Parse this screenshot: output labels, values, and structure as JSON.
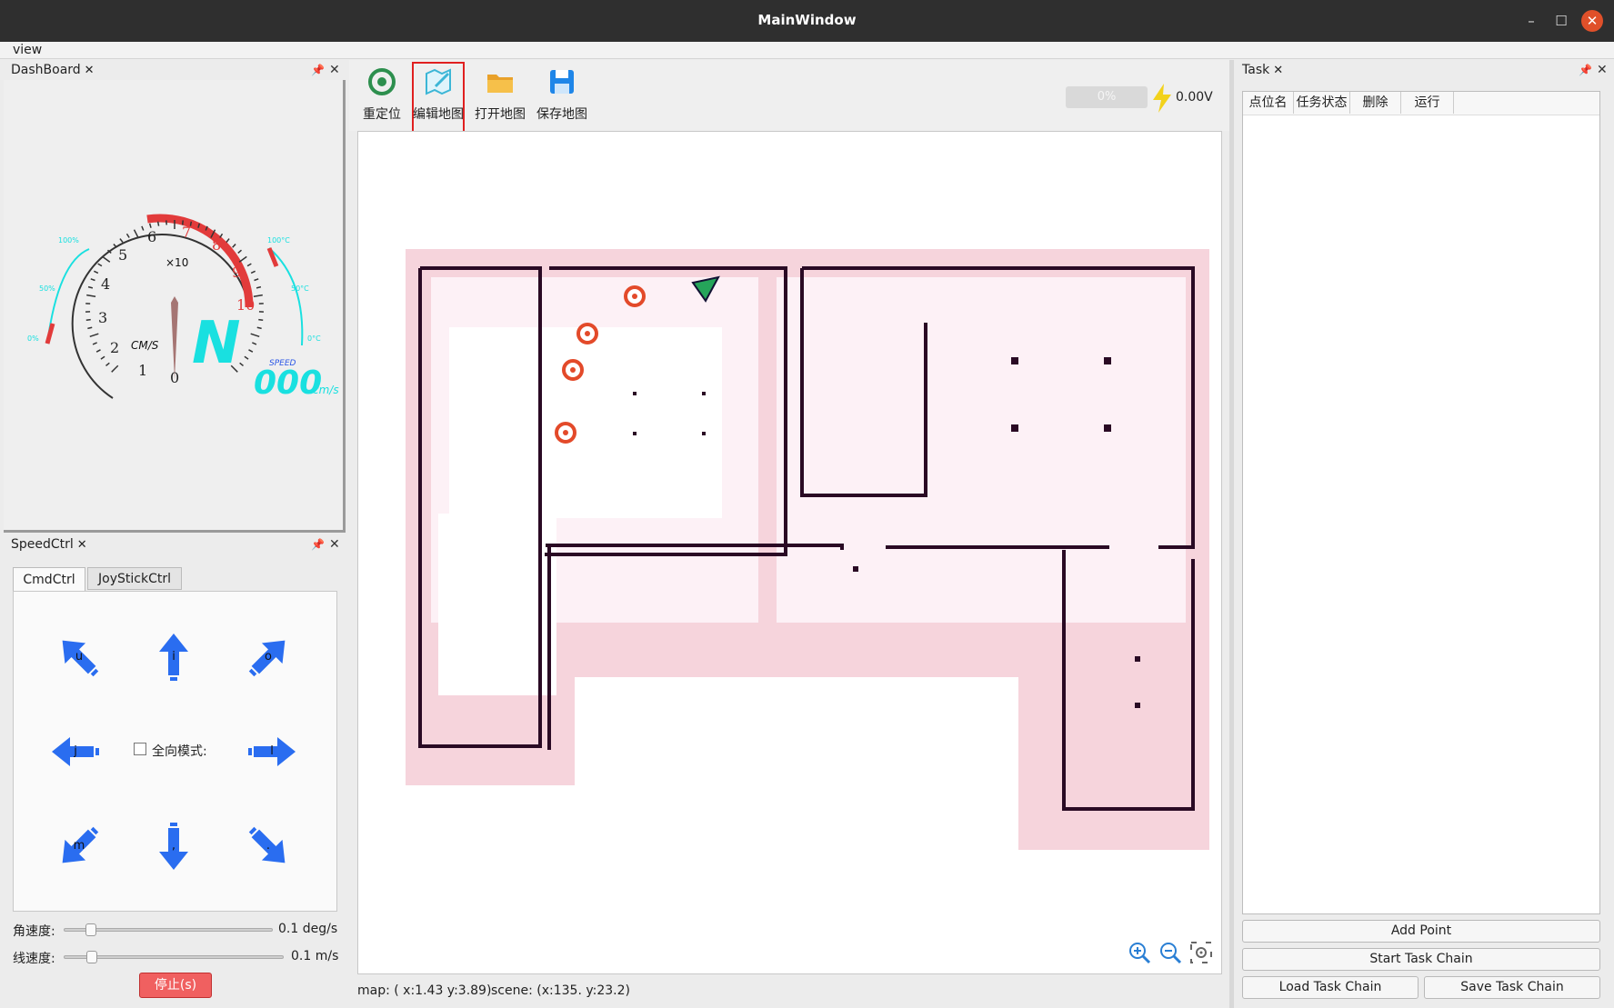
{
  "window": {
    "title": "MainWindow"
  },
  "menu": {
    "view": "view"
  },
  "dashboard": {
    "title": "DashBoard",
    "gauge": {
      "multiplier": "×10",
      "unit": "CM/S",
      "gear": "N",
      "speed_label": "SPEED",
      "speed_value": "000",
      "speed_unit": "cm/s",
      "ticks": [
        "0",
        "1",
        "2",
        "3",
        "4",
        "5",
        "6",
        "7",
        "8",
        "9",
        "10"
      ],
      "left_arc": [
        "100%",
        "50%",
        "0%"
      ],
      "right_arc": [
        "100°C",
        "50°C",
        "0°C"
      ]
    },
    "accent_red": "#e23b3b",
    "accent_cyan": "#19e0e0"
  },
  "speedctrl": {
    "title": "SpeedCtrl",
    "tabs": [
      "CmdCtrl",
      "JoyStickCtrl"
    ],
    "keys": {
      "ul": "u",
      "up": "i",
      "ur": "o",
      "left": "j",
      "right": "l",
      "dl": "m",
      "down": ",",
      "dr": "."
    },
    "omni_label": "全向模式:",
    "angular_label": "角速度:",
    "angular_value": "0.1 deg/s",
    "angular_fraction": 0.1,
    "linear_label": "线速度:",
    "linear_value": "0.1 m/s",
    "linear_fraction": 0.1,
    "stop_button": "停止(s)"
  },
  "toolbar": {
    "relocate": "重定位",
    "edit_map": "编辑地图",
    "open_map": "打开地图",
    "save_map": "保存地图",
    "progress": "0%",
    "voltage": "0.00V"
  },
  "status": {
    "map_coords": "map: ( x:1.43 y:3.89)",
    "scene_coords": "scene: (x:135. y:23.2)"
  },
  "task": {
    "title": "Task",
    "columns": [
      "点位名",
      "任务状态",
      "删除",
      "运行"
    ],
    "add_point": "Add Point",
    "start_chain": "Start Task Chain",
    "load_chain": "Load Task Chain",
    "save_chain": "Save Task Chain"
  }
}
